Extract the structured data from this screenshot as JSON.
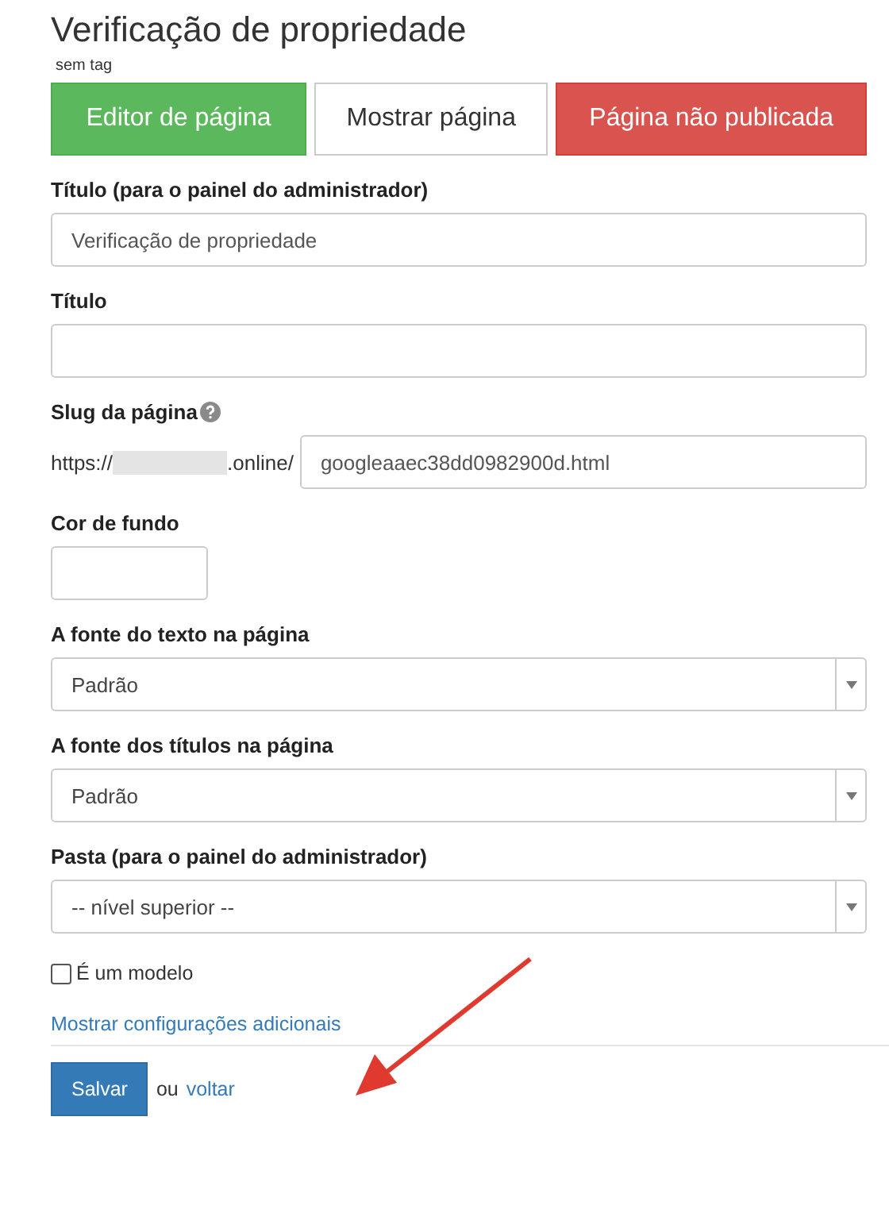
{
  "page_title": "Verificação de propriedade",
  "tag_note": "sem tag",
  "action_buttons": [
    {
      "label": "Editor de página",
      "kind": "success"
    },
    {
      "label": "Mostrar página",
      "kind": "default"
    },
    {
      "label": "Página não publicada",
      "kind": "danger"
    }
  ],
  "fields": [
    {
      "kind": "text",
      "label": "Título (para o painel do administrador)",
      "value": "Verificação de propriedade"
    },
    {
      "kind": "text",
      "label": "Título"
    },
    {
      "kind": "slug",
      "label": "Slug da página",
      "prefix_start": "https://",
      "prefix_end": ".online/",
      "value": "googleaaec38dd0982900d.html"
    },
    {
      "kind": "color",
      "label": "Cor de fundo"
    },
    {
      "kind": "select",
      "label": "A fonte do texto na página",
      "value": "Padrão"
    },
    {
      "kind": "select",
      "label": "A fonte dos títulos na página",
      "value": "Padrão"
    },
    {
      "kind": "select",
      "label": "Pasta (para o painel do administrador)",
      "value": "-- nível superior --"
    }
  ],
  "template_checkbox": {
    "label": "É um modelo",
    "checked": false
  },
  "more_settings_link": "Mostrar configurações adicionais",
  "save_button": "Salvar",
  "or_text": "ou",
  "back_link": "voltar"
}
